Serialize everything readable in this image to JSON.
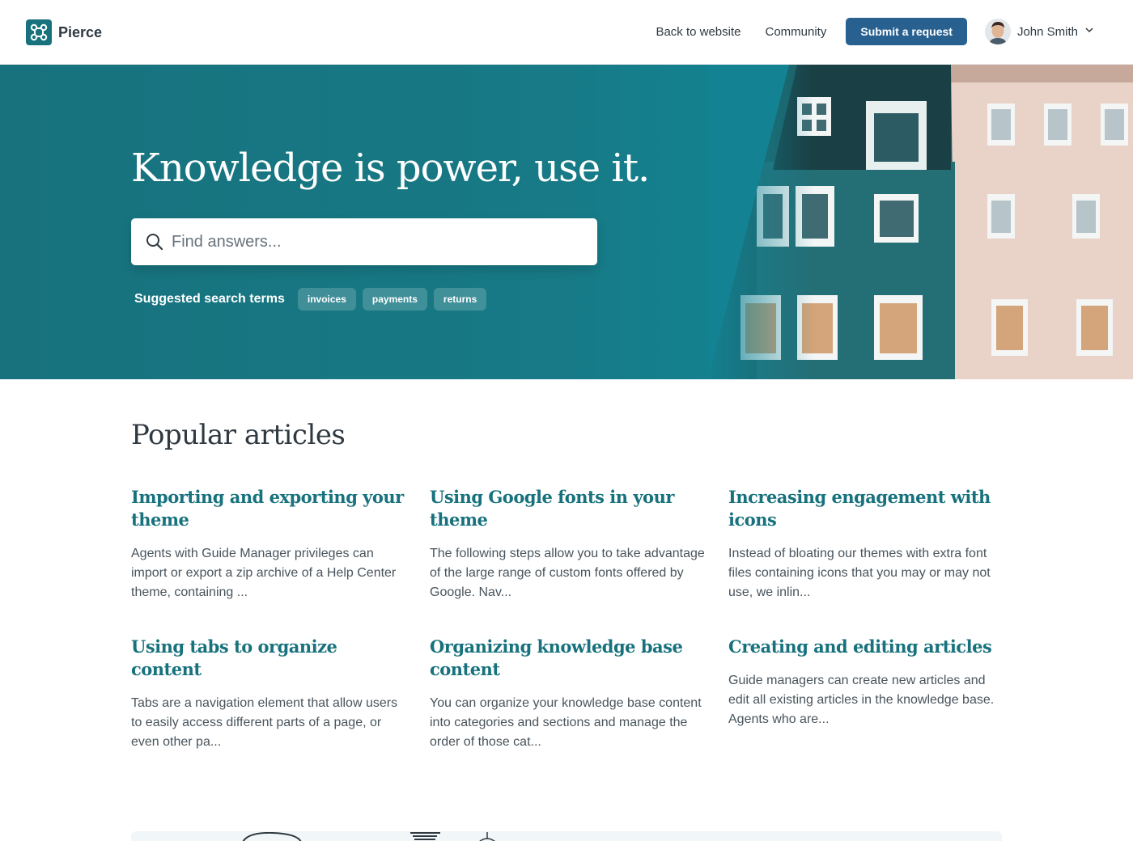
{
  "brand": {
    "name": "Pierce",
    "accent": "#17727d",
    "button": "#286090"
  },
  "nav": {
    "back_to_website": "Back to website",
    "community": "Community",
    "submit_request": "Submit a request",
    "user_name": "John Smith"
  },
  "hero": {
    "title": "Knowledge is power, use it.",
    "search_placeholder": "Find answers...",
    "suggested_label": "Suggested search terms",
    "suggested_terms": [
      "invoices",
      "payments",
      "returns"
    ]
  },
  "popular": {
    "title": "Popular articles",
    "articles": [
      {
        "title": "Importing and exporting your theme",
        "desc": "Agents with Guide Manager privileges can import or export a zip archive of a Help Center theme, containing ..."
      },
      {
        "title": "Using Google fonts in your theme",
        "desc": "The following steps allow you to take advantage of the large range of custom fonts offered by Google. Nav..."
      },
      {
        "title": "Increasing engagement with icons",
        "desc": "Instead of bloating our themes with extra font files containing icons that you may or may not use, we inlin..."
      },
      {
        "title": "Using tabs to organize content",
        "desc": "Tabs are a navigation element that allow users to easily access different parts of a page, or even other pa..."
      },
      {
        "title": "Organizing knowledge base content",
        "desc": "You can organize your knowledge base content into categories and sections and manage the order of those cat..."
      },
      {
        "title": "Creating and editing articles",
        "desc": "Guide managers can create new articles and edit all existing articles in the knowledge base. Agents who are..."
      }
    ]
  }
}
